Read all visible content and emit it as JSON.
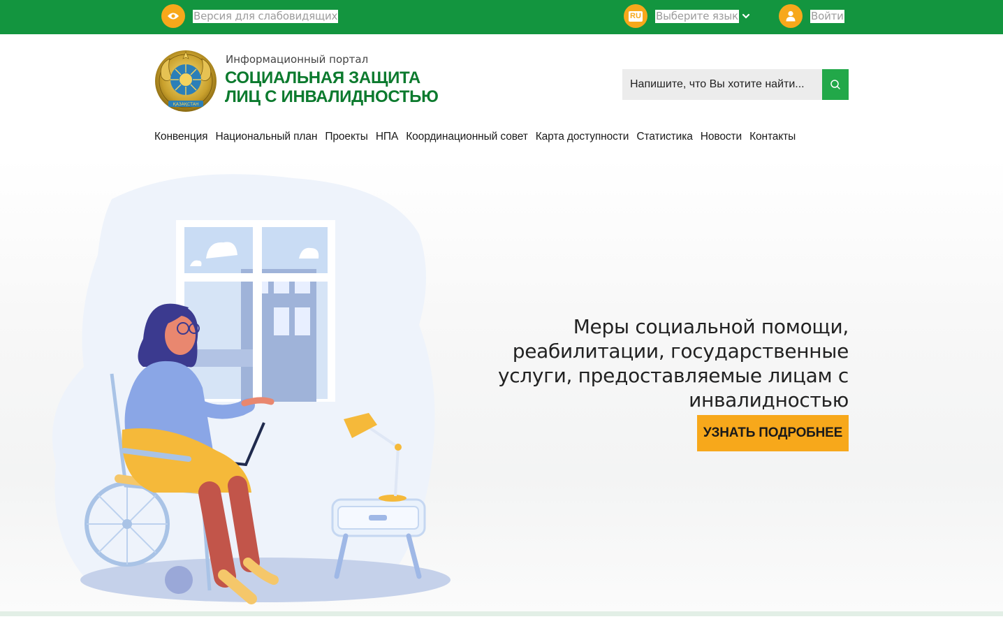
{
  "topbar": {
    "low_vision_label": "Версия для слабовидящих",
    "lang_code": "RU",
    "lang_label": "Выберите язык",
    "login_label": "Войти"
  },
  "header": {
    "portal_subtitle": "Информационный портал",
    "title_line1": "СОЦИАЛЬНАЯ ЗАЩИТА",
    "title_line2": "ЛИЦ С ИНВАЛИДНОСТЬЮ",
    "emblem_text": "ҚАЗАҚСТАН"
  },
  "search": {
    "placeholder": "Напишите, что Вы хотите найти..."
  },
  "nav": {
    "items": [
      {
        "label": "Конвенция"
      },
      {
        "label": "Национальный план"
      },
      {
        "label": "Проекты"
      },
      {
        "label": "НПА"
      },
      {
        "label": "Координационный совет"
      },
      {
        "label": "Карта доступности"
      },
      {
        "label": "Статистика"
      },
      {
        "label": "Новости"
      },
      {
        "label": "Контакты"
      }
    ]
  },
  "hero": {
    "text": "Меры социальной помощи, реабилитации, государственные услуги, предоставляемые лицам с инвалидностью",
    "button_label": "УЗНАТЬ ПОДРОБНЕЕ"
  },
  "colors": {
    "brand_green": "#13953f",
    "accent_orange": "#f7a81b",
    "title_green": "#0c7a2e"
  },
  "icons": {
    "low_vision": "eye-icon",
    "language": "language-icon",
    "dropdown": "chevron-down-icon",
    "user": "user-icon",
    "search": "search-icon"
  }
}
